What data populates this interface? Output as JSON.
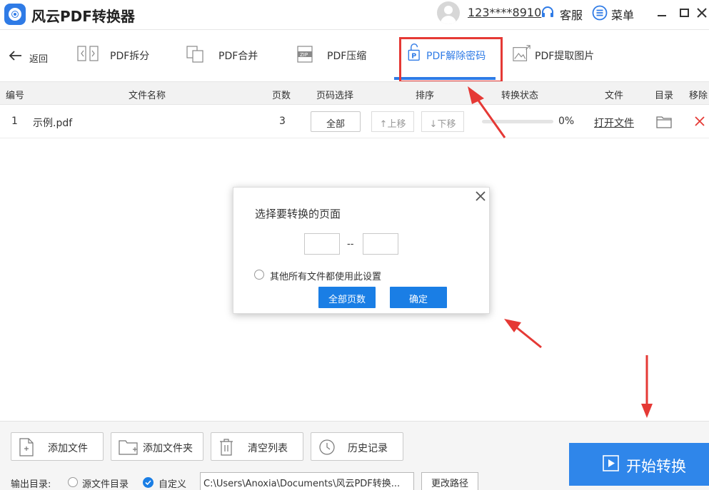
{
  "app": {
    "title": "风云PDF转换器",
    "username": "123****8910",
    "service_label": "客服",
    "menu_label": "菜单"
  },
  "toolbar": {
    "back_label": "返回",
    "tabs": [
      {
        "label": "PDF拆分"
      },
      {
        "label": "PDF合并"
      },
      {
        "label": "PDF压缩"
      },
      {
        "label": "PDF解除密码",
        "active": true
      },
      {
        "label": "PDF提取图片"
      }
    ]
  },
  "table": {
    "headers": [
      "编号",
      "文件名称",
      "页数",
      "页码选择",
      "排序",
      "转换状态",
      "文件",
      "目录",
      "移除"
    ],
    "rows": [
      {
        "index": "1",
        "filename": "示例.pdf",
        "pages": "3",
        "page_select": "全部",
        "move_up": "↑上移",
        "move_down": "↓下移",
        "progress": 0,
        "progress_text": "0%",
        "open_file": "打开文件"
      }
    ]
  },
  "dialog": {
    "title": "选择要转换的页面",
    "from_value": "",
    "to_value": "",
    "separator": "--",
    "apply_all_label": "其他所有文件都使用此设置",
    "apply_all_checked": false,
    "all_pages_button": "全部页数",
    "confirm_button": "确定"
  },
  "bottom": {
    "add_file": "添加文件",
    "add_folder": "添加文件夹",
    "clear_list": "清空列表",
    "history": "历史记录",
    "start": "开始转换",
    "output_label": "输出目录:",
    "source_dir_label": "源文件目录",
    "source_dir_selected": false,
    "custom_label": "自定义",
    "custom_selected": true,
    "path": "C:\\Users\\Anoxia\\Documents\\风云PDF转换...",
    "change_path": "更改路径"
  },
  "colors": {
    "accent": "#2f7be6",
    "button_blue": "#1a7ee5",
    "annotation_red": "#e53935",
    "remove_red": "#e53935"
  }
}
